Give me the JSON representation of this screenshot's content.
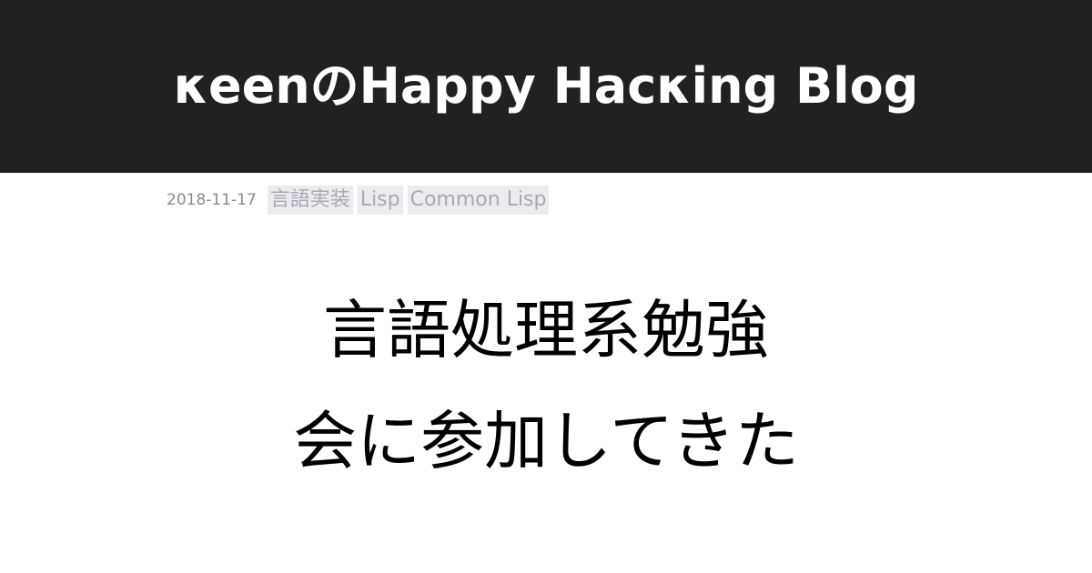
{
  "header": {
    "site_title": "κeenのHappy Hacκing Blog"
  },
  "meta": {
    "date": "2018-11-17",
    "tags": [
      "言語実装",
      "Lisp",
      "Common Lisp"
    ]
  },
  "post": {
    "title_lines": [
      "言語処理系勉強",
      "会に参加してきた"
    ]
  },
  "colors": {
    "header_background": "#212121",
    "header_text": "#ffffff",
    "tag_background": "#ececf0",
    "tag_text": "#a9a9b4",
    "date_text": "#8a8a8a",
    "title_text": "#000000"
  }
}
